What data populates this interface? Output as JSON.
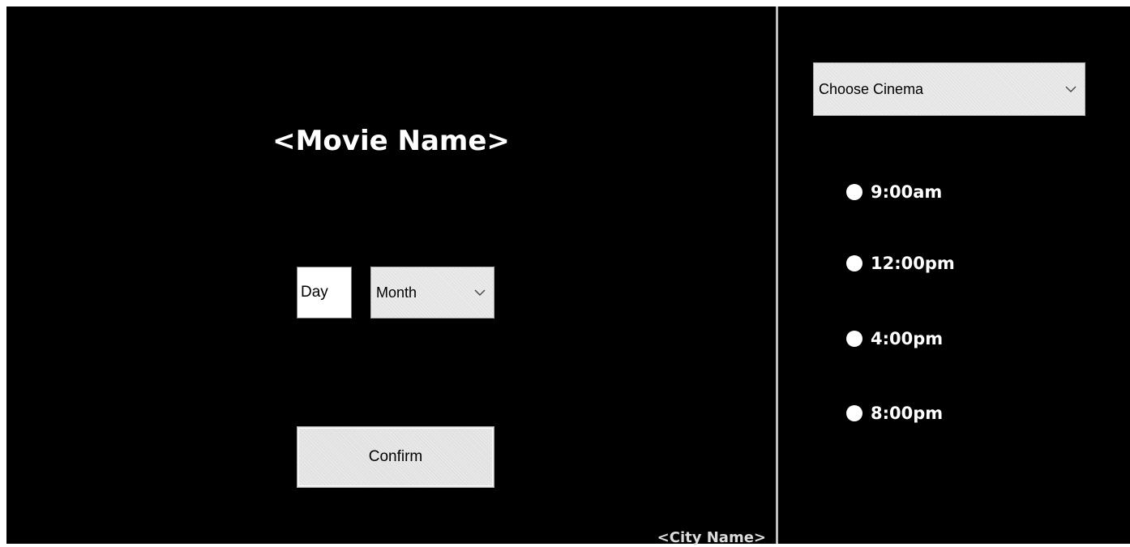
{
  "movie": {
    "title": "<Movie Name>"
  },
  "date": {
    "day_value": "Day",
    "month_selected": "Month"
  },
  "confirm_label": "Confirm",
  "city_label": "<City Name>",
  "cinema": {
    "selected": "Choose Cinema"
  },
  "showtimes": [
    {
      "label": "9:00am",
      "selected": true
    },
    {
      "label": "12:00pm",
      "selected": true
    },
    {
      "label": "4:00pm",
      "selected": true
    },
    {
      "label": "8:00pm",
      "selected": true
    }
  ],
  "icons": {
    "dropdown": "chevron-down-icon",
    "radio": "radio-dot-icon"
  },
  "colors": {
    "background": "#000000",
    "text": "#ffffff",
    "control": "#e4e4e4",
    "divider": "#bdbdbd"
  }
}
